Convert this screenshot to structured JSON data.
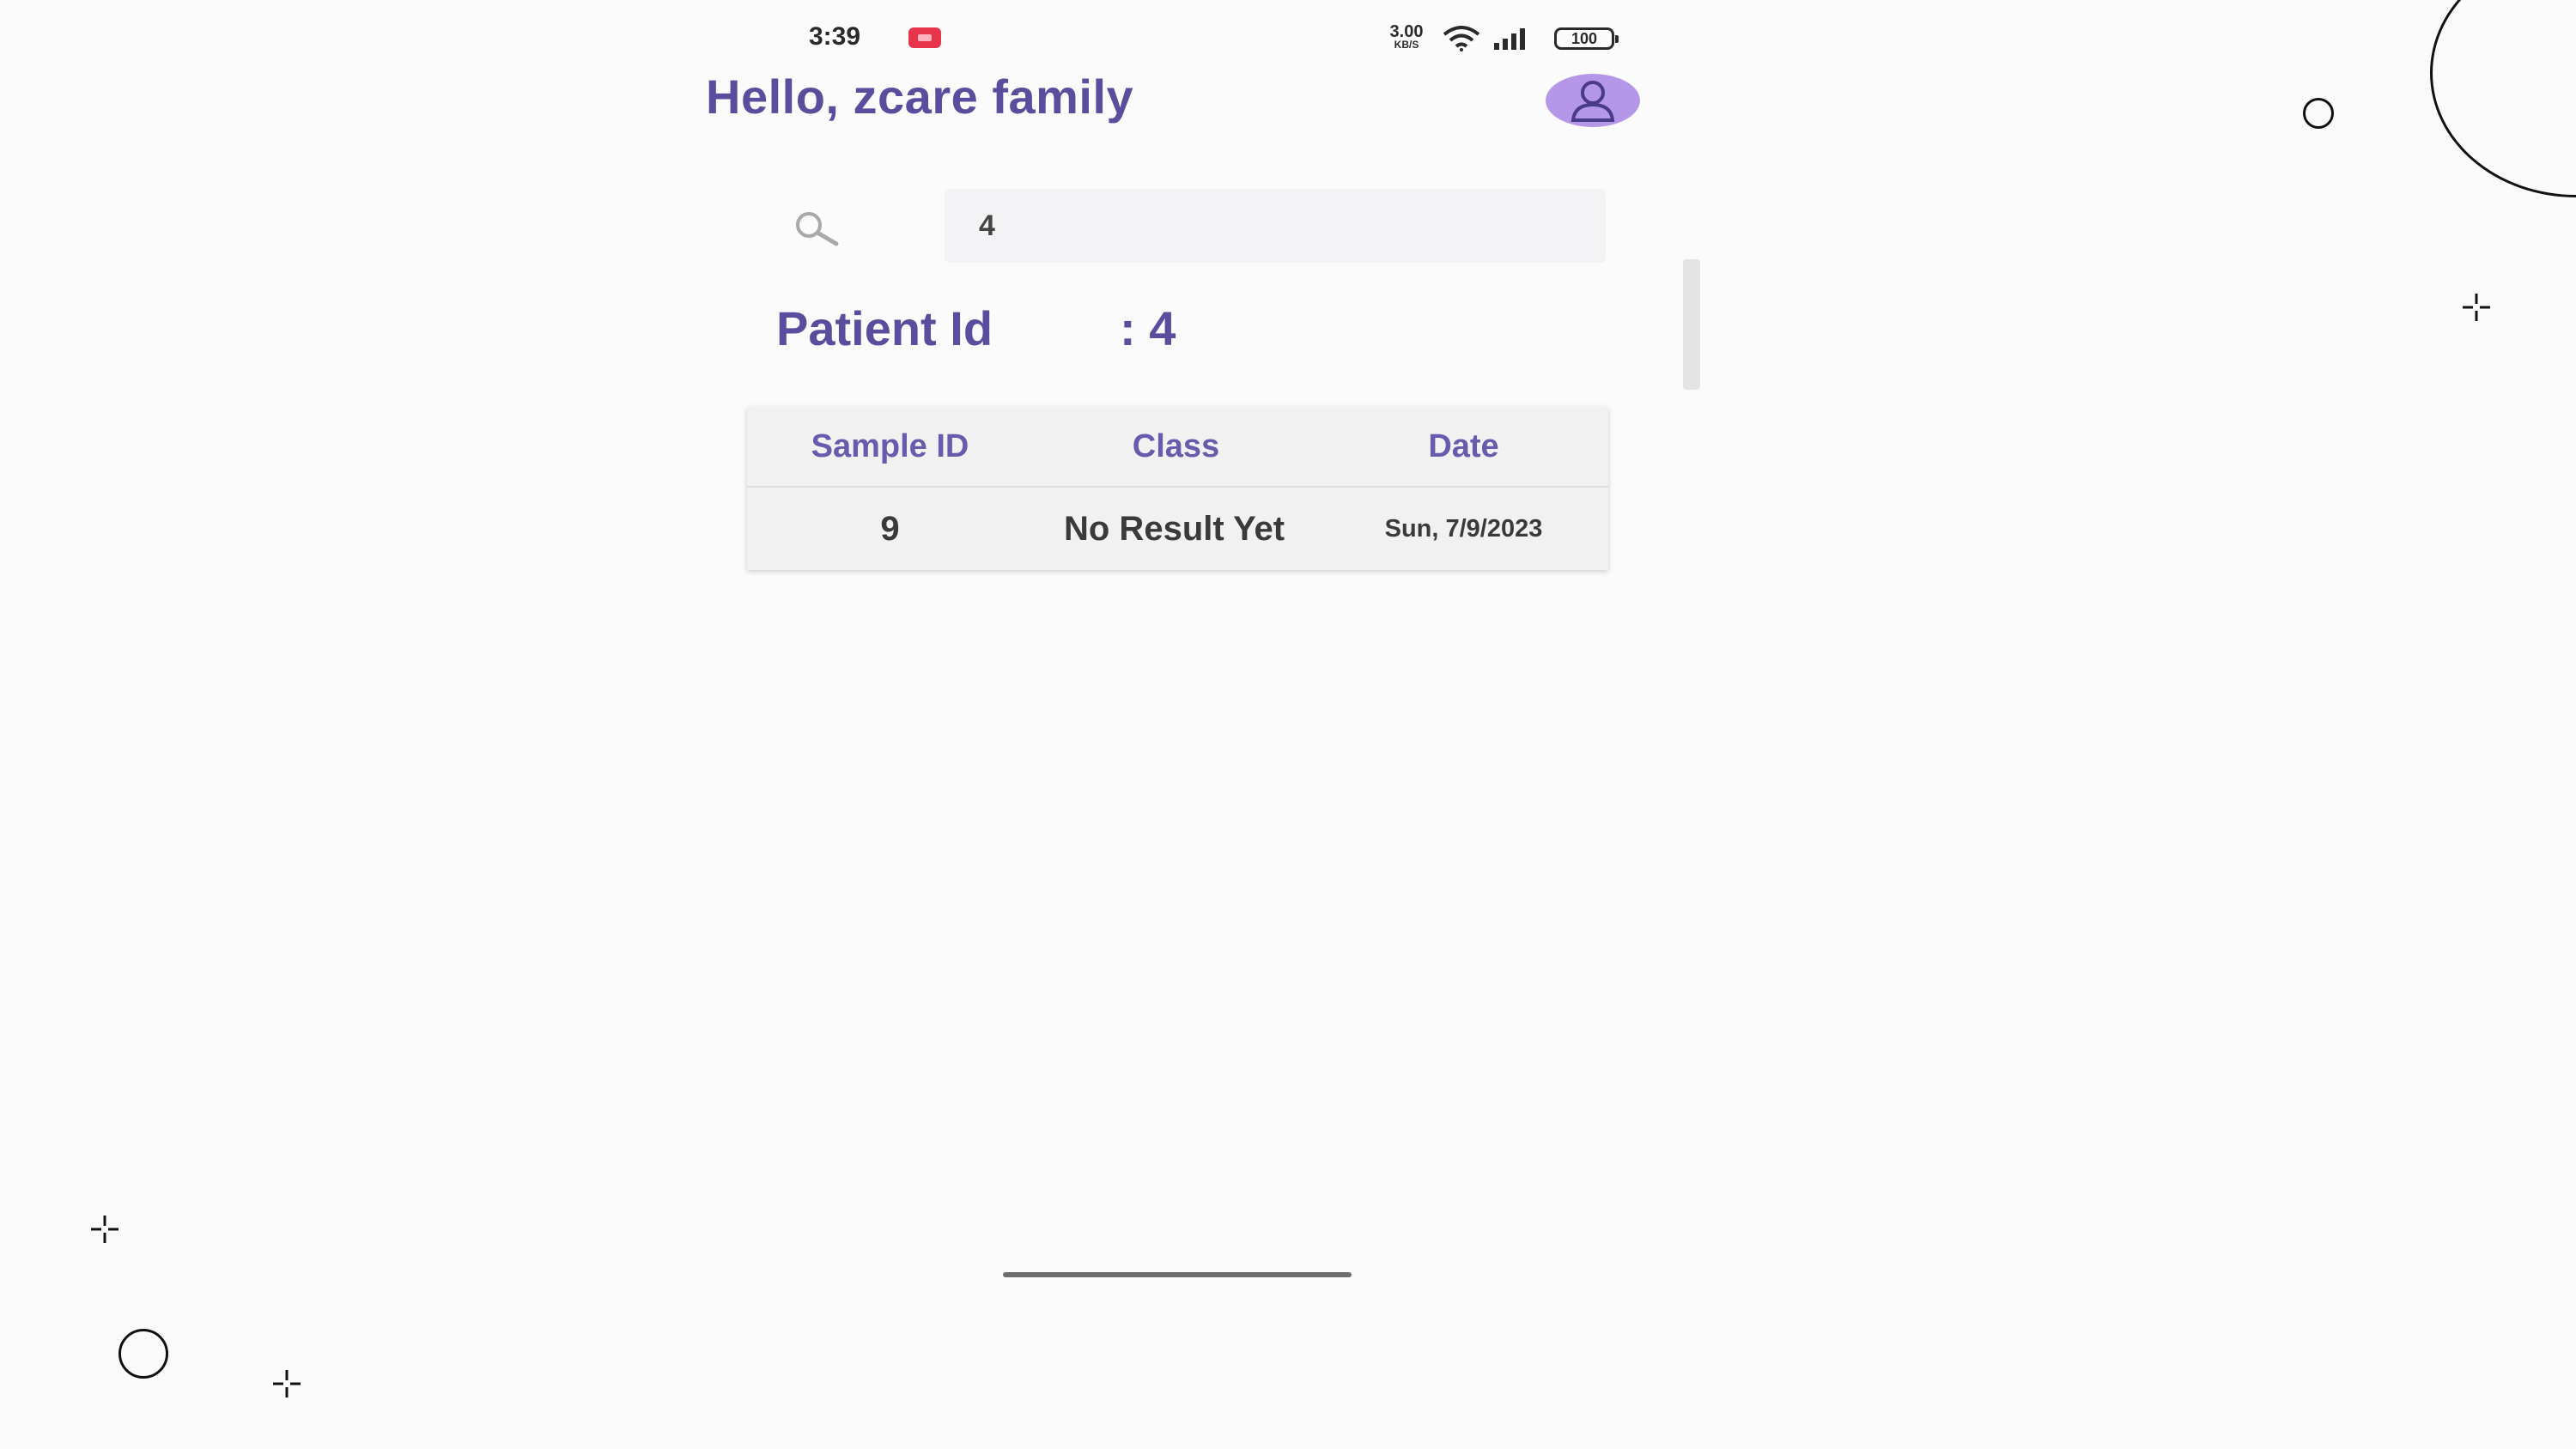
{
  "status_bar": {
    "time": "3:39",
    "network_speed": "3.00",
    "network_speed_unit": "KB/S",
    "battery": "100",
    "notification_icon": "app-notification-icon",
    "wifi_icon": "wifi-icon",
    "signal_icon": "signal-bars-icon"
  },
  "header": {
    "greeting": "Hello, zcare family",
    "avatar_icon": "user-avatar-icon"
  },
  "search": {
    "icon": "search-icon",
    "value": "4"
  },
  "patient": {
    "label": "Patient Id",
    "separator": ":",
    "value": "4"
  },
  "results_table": {
    "columns": [
      "Sample ID",
      "Class",
      "Date"
    ],
    "rows": [
      {
        "sample_id": "9",
        "class": "No Result Yet",
        "date": "Sun, 7/9/2023"
      }
    ]
  },
  "colors": {
    "accent": "#5c4c9e",
    "header_text": "#6a5aad",
    "avatar_bg": "#b497e8",
    "notification": "#e8344a"
  }
}
